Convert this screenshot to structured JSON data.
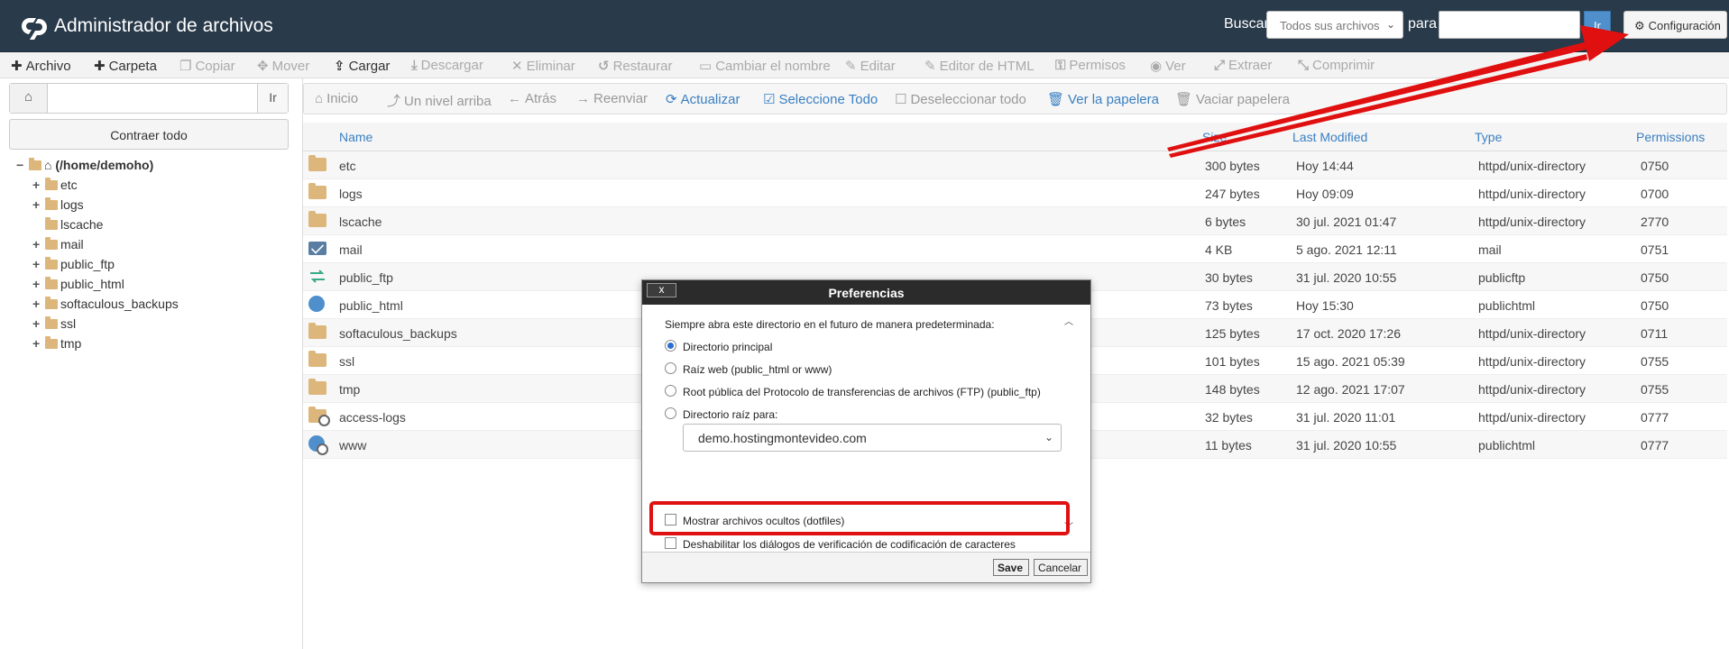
{
  "header": {
    "app_title": "Administrador de archivos",
    "search_label": "Buscar",
    "search_scope": "Todos sus archivos",
    "para_label": "para",
    "search_placeholder": "",
    "go_label": "Ir",
    "config_label": "Configuración"
  },
  "toolbar": {
    "items": [
      {
        "label": "Archivo",
        "icon": "plus-icon",
        "enabled": true
      },
      {
        "label": "Carpeta",
        "icon": "plus-icon",
        "enabled": true
      },
      {
        "label": "Copiar",
        "icon": "copy-icon",
        "enabled": false
      },
      {
        "label": "Mover",
        "icon": "move-icon",
        "enabled": false
      },
      {
        "label": "Cargar",
        "icon": "upload-icon",
        "enabled": true
      },
      {
        "label": "Descargar",
        "icon": "download-icon",
        "enabled": false
      },
      {
        "label": "Eliminar",
        "icon": "times-icon",
        "enabled": false
      },
      {
        "label": "Restaurar",
        "icon": "undo-icon",
        "enabled": false
      },
      {
        "label": "Cambiar el nombre",
        "icon": "rename-icon",
        "enabled": false
      },
      {
        "label": "Editar",
        "icon": "pencil-icon",
        "enabled": false
      },
      {
        "label": "Editor de HTML",
        "icon": "edit-icon",
        "enabled": false
      },
      {
        "label": "Permisos",
        "icon": "key-icon",
        "enabled": false
      },
      {
        "label": "Ver",
        "icon": "eye-icon",
        "enabled": false
      },
      {
        "label": "Extraer",
        "icon": "expand-icon",
        "enabled": false
      },
      {
        "label": "Comprimir",
        "icon": "compress-icon",
        "enabled": false
      }
    ]
  },
  "left": {
    "path_value": "",
    "go_label": "Ir",
    "collapse_label": "Contraer todo",
    "tree": [
      {
        "label": "(/home/demoho)",
        "toggle": "−",
        "root": true
      },
      {
        "label": "etc",
        "toggle": "+"
      },
      {
        "label": "logs",
        "toggle": "+"
      },
      {
        "label": "lscache",
        "toggle": ""
      },
      {
        "label": "mail",
        "toggle": "+"
      },
      {
        "label": "public_ftp",
        "toggle": "+"
      },
      {
        "label": "public_html",
        "toggle": "+"
      },
      {
        "label": "softaculous_backups",
        "toggle": "+"
      },
      {
        "label": "ssl",
        "toggle": "+"
      },
      {
        "label": "tmp",
        "toggle": "+"
      }
    ]
  },
  "nav": {
    "items": [
      {
        "label": "Inicio",
        "icon": "home-icon",
        "style": "muted"
      },
      {
        "label": "Un nivel arriba",
        "icon": "level-up-icon",
        "style": "muted"
      },
      {
        "label": "Atrás",
        "icon": "arrow-left-icon",
        "style": "muted"
      },
      {
        "label": "Reenviar",
        "icon": "arrow-right-icon",
        "style": "muted"
      },
      {
        "label": "Actualizar",
        "icon": "refresh-icon",
        "style": "blue"
      },
      {
        "label": "Seleccione Todo",
        "icon": "check-square-icon",
        "style": "blue"
      },
      {
        "label": "Deseleccionar todo",
        "icon": "square-icon",
        "style": "muted"
      },
      {
        "label": "Ver la papelera",
        "icon": "trash-icon",
        "style": "blue"
      },
      {
        "label": "Vaciar papelera",
        "icon": "trash-icon",
        "style": "muted"
      }
    ]
  },
  "table": {
    "columns": [
      "Name",
      "Size",
      "Last Modified",
      "Type",
      "Permissions"
    ],
    "rows": [
      {
        "icon": "folder",
        "name": "etc",
        "size": "300 bytes",
        "modified": "Hoy 14:44",
        "type": "httpd/unix-directory",
        "perms": "0750"
      },
      {
        "icon": "folder",
        "name": "logs",
        "size": "247 bytes",
        "modified": "Hoy 09:09",
        "type": "httpd/unix-directory",
        "perms": "0700"
      },
      {
        "icon": "folder",
        "name": "lscache",
        "size": "6 bytes",
        "modified": "30 jul. 2021 01:47",
        "type": "httpd/unix-directory",
        "perms": "2770"
      },
      {
        "icon": "mail",
        "name": "mail",
        "size": "4 KB",
        "modified": "5 ago. 2021 12:11",
        "type": "mail",
        "perms": "0751"
      },
      {
        "icon": "ftp",
        "name": "public_ftp",
        "size": "30 bytes",
        "modified": "31 jul. 2020 10:55",
        "type": "publicftp",
        "perms": "0750"
      },
      {
        "icon": "globe",
        "name": "public_html",
        "size": "73 bytes",
        "modified": "Hoy 15:30",
        "type": "publichtml",
        "perms": "0750"
      },
      {
        "icon": "folder",
        "name": "softaculous_backups",
        "size": "125 bytes",
        "modified": "17 oct. 2020 17:26",
        "type": "httpd/unix-directory",
        "perms": "0711"
      },
      {
        "icon": "folder",
        "name": "ssl",
        "size": "101 bytes",
        "modified": "15 ago. 2021 05:39",
        "type": "httpd/unix-directory",
        "perms": "0755"
      },
      {
        "icon": "folder",
        "name": "tmp",
        "size": "148 bytes",
        "modified": "12 ago. 2021 17:07",
        "type": "httpd/unix-directory",
        "perms": "0755"
      },
      {
        "icon": "linkfolder",
        "name": "access-logs",
        "size": "32 bytes",
        "modified": "31 jul. 2020 11:01",
        "type": "httpd/unix-directory",
        "perms": "0777"
      },
      {
        "icon": "linkglobe",
        "name": "www",
        "size": "11 bytes",
        "modified": "31 jul. 2020 10:55",
        "type": "publichtml",
        "perms": "0777"
      }
    ]
  },
  "modal": {
    "title": "Preferencias",
    "close_label": "x",
    "intro": "Siempre abra este directorio en el futuro de manera predeterminada:",
    "options": [
      {
        "label": "Directorio principal",
        "checked": true
      },
      {
        "label": "Raíz web (public_html or www)",
        "checked": false
      },
      {
        "label": "Root pública del Protocolo de transferencias de archivos (FTP) (public_ftp)",
        "checked": false
      },
      {
        "label": "Directorio raíz para:",
        "checked": false
      }
    ],
    "domain_value": "demo.hostingmontevideo.com",
    "checkboxes": [
      {
        "label": "Mostrar archivos ocultos (dotfiles)",
        "checked": false
      },
      {
        "label": "Deshabilitar los diálogos de verificación de codificación de caracteres",
        "checked": false
      }
    ],
    "save_label": "Save",
    "cancel_label": "Cancelar"
  },
  "colors": {
    "header_bg": "#293a4a",
    "link_blue": "#3a7fc2",
    "highlight_red": "#e01010",
    "folder": "#dcb67a"
  }
}
